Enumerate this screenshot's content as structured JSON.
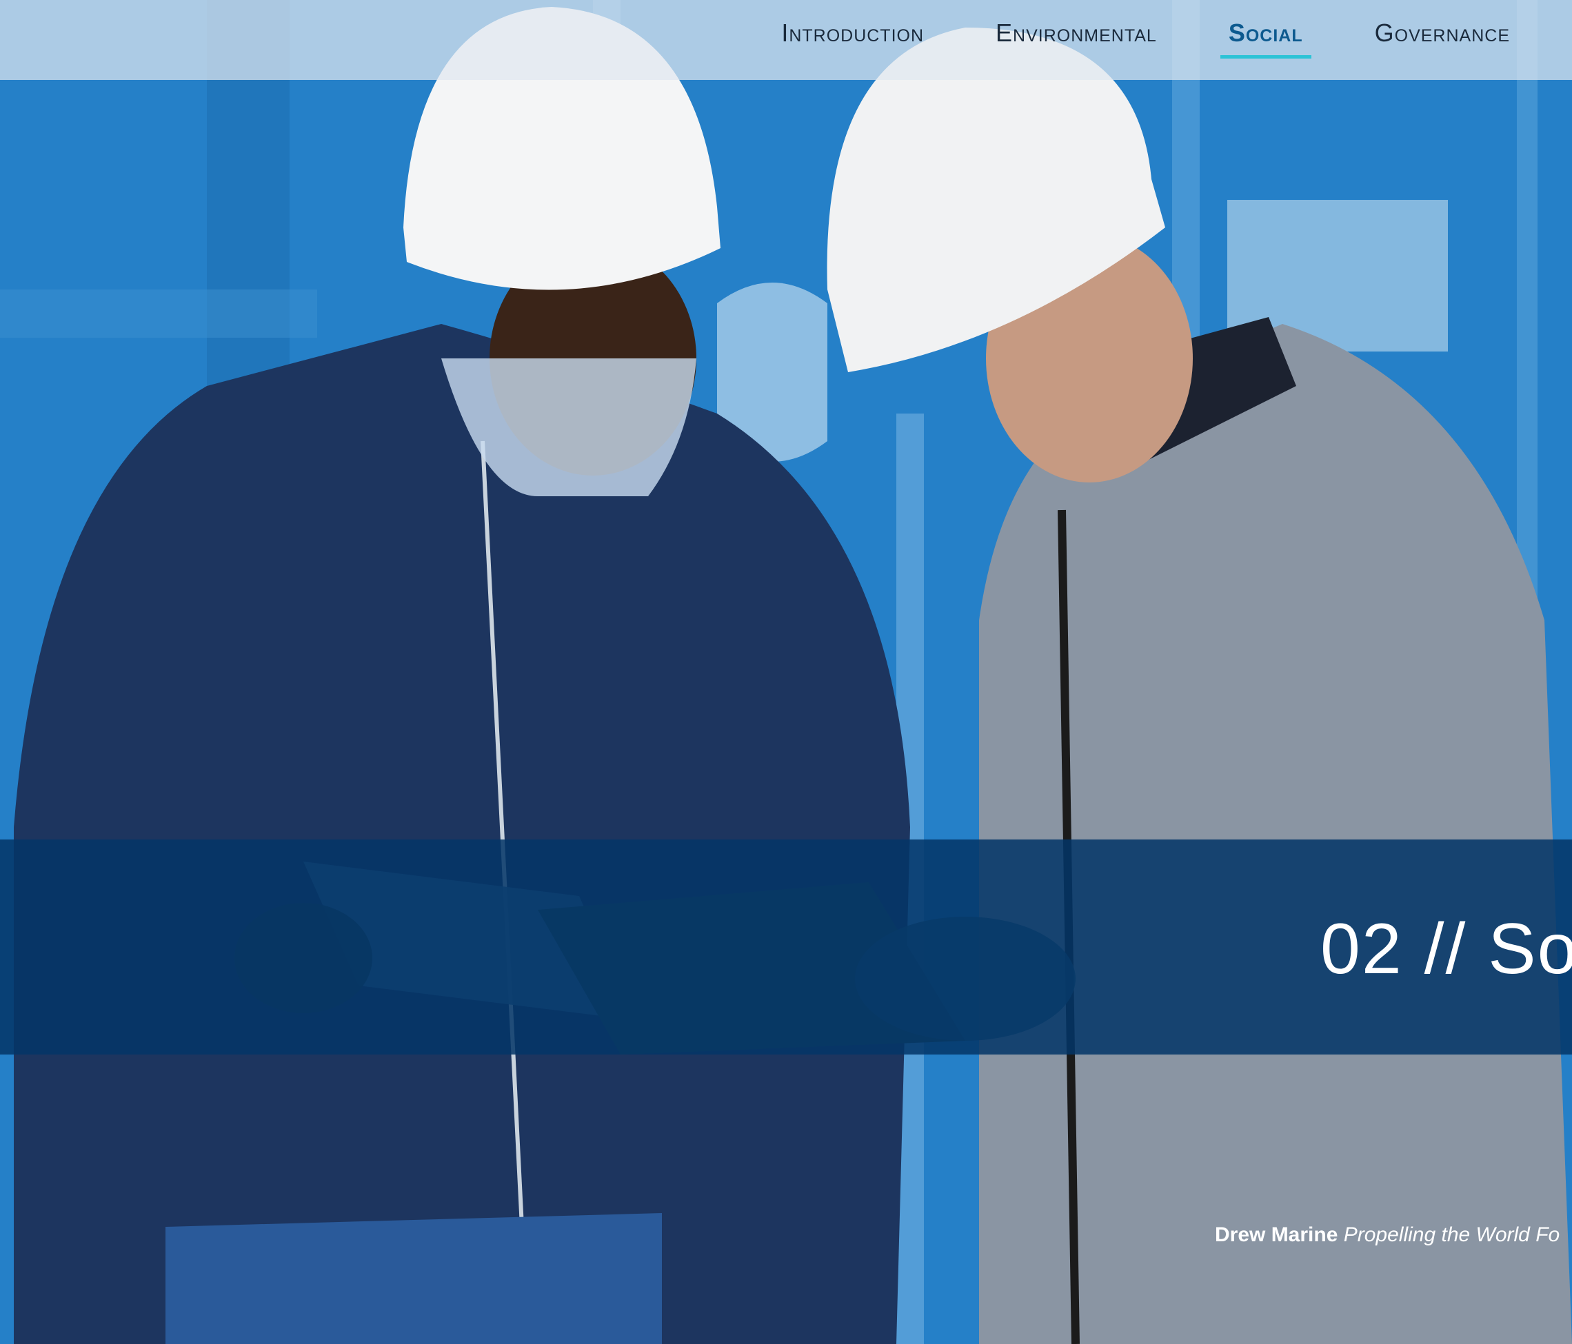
{
  "nav": {
    "items": [
      {
        "label": "Introduction",
        "active": false
      },
      {
        "label": "Environmental",
        "active": false
      },
      {
        "label": "Social",
        "active": true
      },
      {
        "label": "Governance",
        "active": false
      }
    ]
  },
  "section": {
    "title": "02 // So"
  },
  "footer": {
    "brand": "Drew Marine",
    "tagline": "Propelling the World Fo"
  },
  "colors": {
    "accent_underline": "#2cc3d6",
    "active_nav": "#0d5a8f",
    "band": "#043668"
  },
  "hero": {
    "image": "two-workers-in-hard-hats-reviewing-clipboard"
  }
}
